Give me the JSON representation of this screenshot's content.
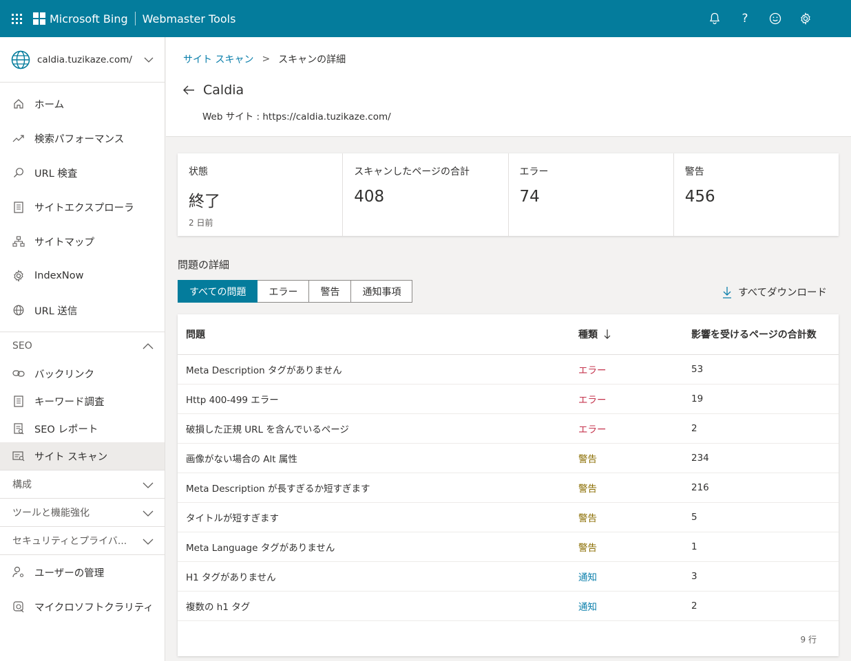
{
  "topbar": {
    "brand": "Microsoft Bing",
    "product": "Webmaster Tools",
    "icons": [
      "waffle-icon",
      "bell-icon",
      "help-icon",
      "smiley-icon",
      "gear-icon"
    ],
    "help_glyph": "?",
    "accent": "#047c9c"
  },
  "sidebar": {
    "site": "caldia.tuzikaze.com/",
    "items": [
      {
        "label": "ホーム",
        "icon": "home-icon"
      },
      {
        "label": "検索パフォーマンス",
        "icon": "trend-icon"
      },
      {
        "label": "URL 検査",
        "icon": "search-icon"
      },
      {
        "label": "サイトエクスプローラ",
        "icon": "document-icon"
      },
      {
        "label": "サイトマップ",
        "icon": "sitemap-icon"
      },
      {
        "label": "IndexNow",
        "icon": "gear-icon"
      },
      {
        "label": "URL 送信",
        "icon": "globe-icon"
      }
    ],
    "seo_section": "SEO",
    "seo_items": [
      {
        "label": "バックリンク",
        "icon": "link-icon"
      },
      {
        "label": "キーワード調査",
        "icon": "document-icon"
      },
      {
        "label": "SEO レポート",
        "icon": "report-icon"
      },
      {
        "label": "サイト スキャン",
        "icon": "scan-icon"
      }
    ],
    "collapsed_sections": [
      "構成",
      "ツールと機能強化",
      "セキュリティとプライバ..."
    ],
    "bottom_items": [
      {
        "label": "ユーザーの管理",
        "icon": "user-settings-icon"
      },
      {
        "label": "マイクロソフトクラリティ",
        "icon": "clarity-icon"
      }
    ]
  },
  "header": {
    "breadcrumb_link": "サイト スキャン",
    "breadcrumb_sep": ">",
    "breadcrumb_current": "スキャンの詳細",
    "title": "Caldia",
    "subtitle": "Web サイト : https://caldia.tuzikaze.com/"
  },
  "stats": [
    {
      "label": "状態",
      "value": "終了",
      "sub": "2 日前"
    },
    {
      "label": "スキャンしたページの合計",
      "value": "408",
      "sub": ""
    },
    {
      "label": "エラー",
      "value": "74",
      "sub": ""
    },
    {
      "label": "警告",
      "value": "456",
      "sub": ""
    }
  ],
  "issues": {
    "title": "問題の詳細",
    "tabs": [
      "すべての問題",
      "エラー",
      "警告",
      "通知事項"
    ],
    "active_tab": 0,
    "download_label": "すべてダウンロード",
    "columns": [
      "問題",
      "種類",
      "影響を受けるページの合計数"
    ],
    "rows": [
      {
        "issue": "Meta Description タグがありません",
        "type": "エラー",
        "kind": "error",
        "count": "53"
      },
      {
        "issue": "Http 400-499 エラー",
        "type": "エラー",
        "kind": "error",
        "count": "19"
      },
      {
        "issue": "破損した正規 URL を含んでいるページ",
        "type": "エラー",
        "kind": "error",
        "count": "2"
      },
      {
        "issue": "画像がない場合の Alt 属性",
        "type": "警告",
        "kind": "warn",
        "count": "234"
      },
      {
        "issue": "Meta Description が長すぎるか短すぎます",
        "type": "警告",
        "kind": "warn",
        "count": "216"
      },
      {
        "issue": "タイトルが短すぎます",
        "type": "警告",
        "kind": "warn",
        "count": "5"
      },
      {
        "issue": "Meta Language タグがありません",
        "type": "警告",
        "kind": "warn",
        "count": "1"
      },
      {
        "issue": "H1 タグがありません",
        "type": "通知",
        "kind": "info",
        "count": "3"
      },
      {
        "issue": "複数の h1 タグ",
        "type": "通知",
        "kind": "info",
        "count": "2"
      }
    ],
    "row_count": "9 行",
    "colors": {
      "error": "#c4314b",
      "warn": "#8a6d00",
      "info": "#0b7fab"
    }
  }
}
